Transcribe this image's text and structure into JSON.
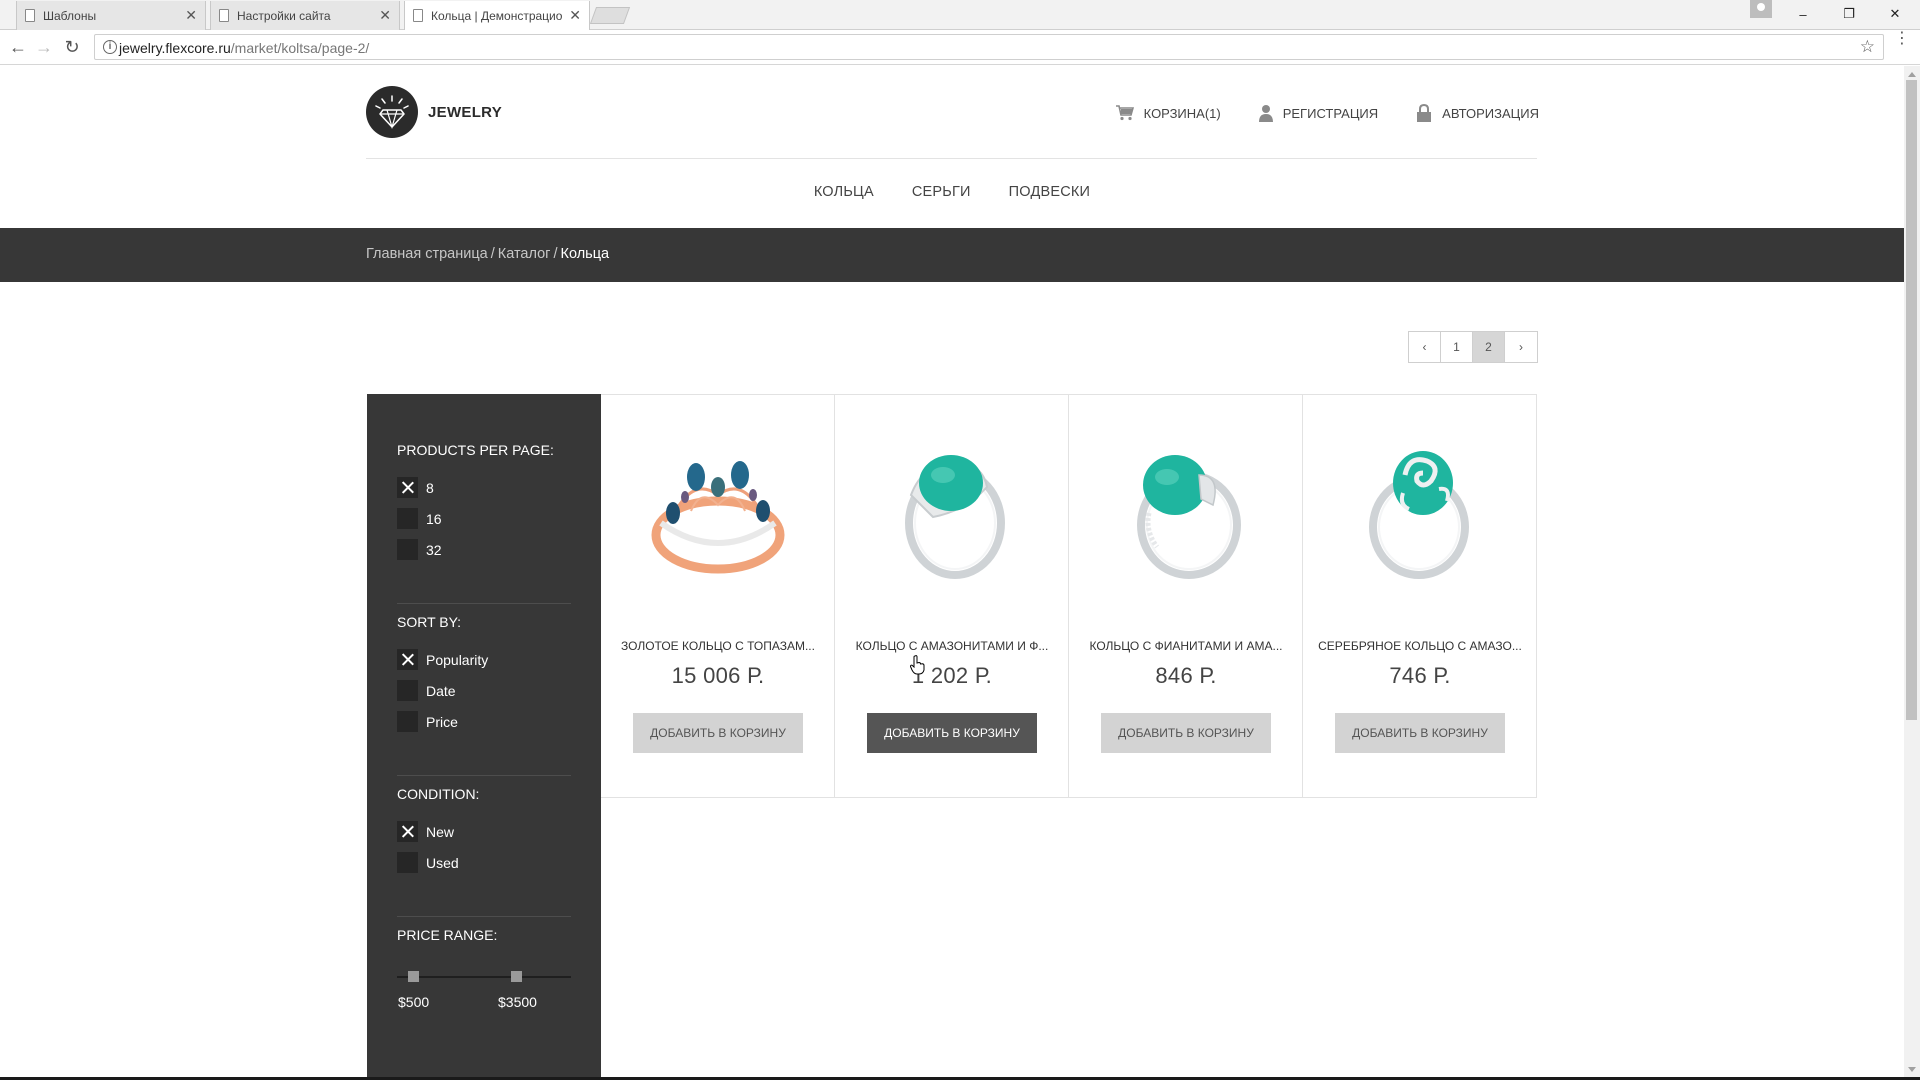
{
  "browser": {
    "tabs": [
      {
        "label": "Шаблоны",
        "active": false
      },
      {
        "label": "Настройки сайта",
        "active": false
      },
      {
        "label": "Кольца | Демонстрацио",
        "active": true
      }
    ],
    "url_host": "jewelry.flexcore.ru",
    "url_path": "/market/koltsa/page-2/",
    "window_controls": {
      "minimize": "–",
      "restore": "❐",
      "close": "✕"
    },
    "tab_close": "✕",
    "back": "←",
    "forward": "→",
    "reload": "↻",
    "info": "i",
    "star": "☆",
    "menu": "⋮"
  },
  "site": {
    "logo_text": "JEWELRY",
    "user_links": {
      "cart": "КОРЗИНА(1)",
      "register": "РЕГИСТРАЦИЯ",
      "login": "АВТОРИЗАЦИЯ"
    },
    "nav": [
      "КОЛЬЦА",
      "СЕРЬГИ",
      "ПОДВЕСКИ"
    ],
    "breadcrumb": {
      "home": "Главная страница",
      "catalog": "Каталог",
      "current": "Кольца",
      "separator": "/"
    },
    "pager": {
      "prev": "‹",
      "pages": [
        "1",
        "2"
      ],
      "current": "2",
      "next": "›"
    }
  },
  "filters": {
    "per_page": {
      "title": "PRODUCTS PER PAGE:",
      "options": [
        {
          "label": "8",
          "checked": true
        },
        {
          "label": "16",
          "checked": false
        },
        {
          "label": "32",
          "checked": false
        }
      ]
    },
    "sort": {
      "title": "SORT BY:",
      "options": [
        {
          "label": "Popularity",
          "checked": true
        },
        {
          "label": "Date",
          "checked": false
        },
        {
          "label": "Price",
          "checked": false
        }
      ]
    },
    "condition": {
      "title": "CONDITION:",
      "options": [
        {
          "label": "New",
          "checked": true
        },
        {
          "label": "Used",
          "checked": false
        }
      ]
    },
    "price_range": {
      "title": "PRICE RANGE:",
      "min": "$500",
      "max": "$3500"
    }
  },
  "products": [
    {
      "title": "ЗОЛОТОЕ КОЛЬЦО С ТОПАЗАМ...",
      "price": "15 006 Р.",
      "button": "ДОБАВИТЬ В КОРЗИНУ",
      "image": "gold-crown-ring-topaz"
    },
    {
      "title": "КОЛЬЦО С АМАЗОНИТАМИ И Ф...",
      "price": "1 202 Р.",
      "button": "ДОБАВИТЬ В КОРЗИНУ",
      "image": "silver-ring-amazonite-round"
    },
    {
      "title": "КОЛЬЦО С ФИАНИТАМИ И АМА...",
      "price": "846 Р.",
      "button": "ДОБАВИТЬ В КОРЗИНУ",
      "image": "silver-ring-amazonite-leaf"
    },
    {
      "title": "СЕРЕБРЯНОЕ КОЛЬЦО С АМАЗО...",
      "price": "746 Р.",
      "button": "ДОБАВИТЬ В КОРЗИНУ",
      "image": "silver-ring-amazonite-swirl"
    }
  ],
  "colors": {
    "dark_panel": "#373737",
    "accent_stone": "#1fb59f",
    "button_default": "#d3d3d3",
    "button_hover": "#555555"
  }
}
